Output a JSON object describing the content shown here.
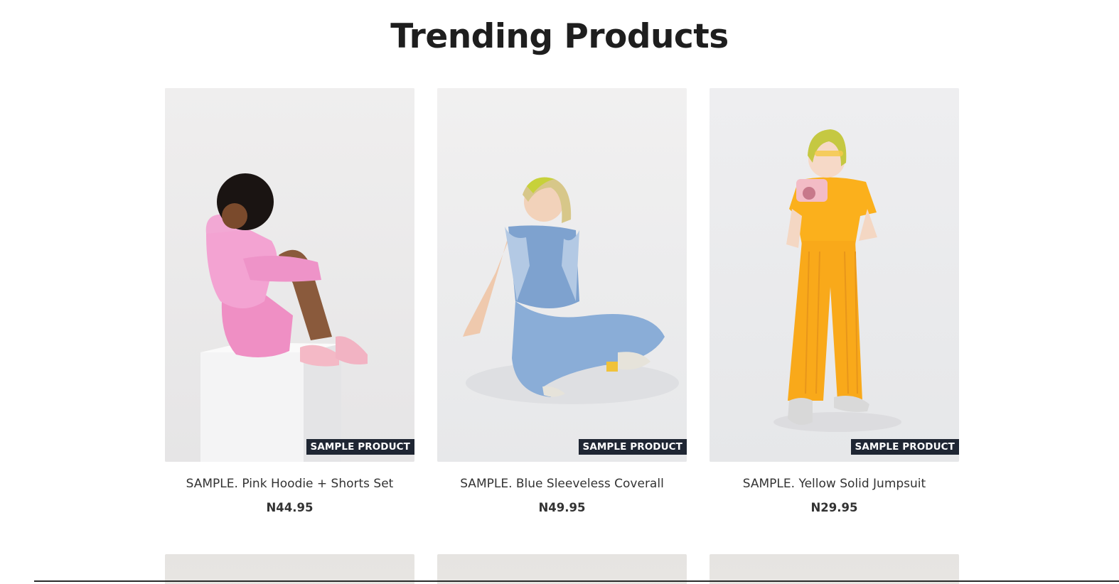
{
  "section": {
    "title": "Trending Products"
  },
  "products": [
    {
      "title": "SAMPLE. Pink Hoodie + Shorts Set",
      "price": "N44.95",
      "badge": "SAMPLE PRODUCT",
      "image_icon": "girl-pink-hoodie-photo"
    },
    {
      "title": "SAMPLE. Blue Sleeveless Coverall",
      "price": "N49.95",
      "badge": "SAMPLE PRODUCT",
      "image_icon": "kid-denim-coverall-photo"
    },
    {
      "title": "SAMPLE. Yellow Solid Jumpsuit",
      "price": "N29.95",
      "badge": "SAMPLE PRODUCT",
      "image_icon": "kid-yellow-jumpsuit-photo"
    }
  ],
  "colors": {
    "badge_bg": "#1f2633",
    "text": "#333333",
    "heading": "#1e1e1e"
  }
}
